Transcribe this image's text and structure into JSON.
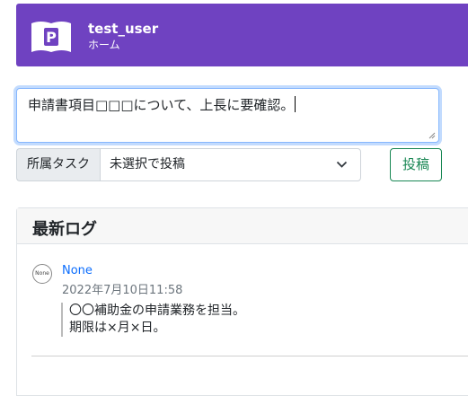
{
  "header": {
    "logo_icon": "book-p-logo-icon",
    "user_name": "test_user",
    "subtitle": "ホーム",
    "background_color": "#6f42c1"
  },
  "post_form": {
    "textarea_value": "申請書項目□□□について、上長に要確認。",
    "task_label": "所属タスク",
    "task_select_value": "未選択で投稿",
    "submit_label": "投稿",
    "submit_color": "#198754"
  },
  "log": {
    "title": "最新ログ",
    "entries": [
      {
        "avatar_text": "None",
        "author": "None",
        "timestamp": "2022年7月10日11:58",
        "lines": [
          "〇〇補助金の申請業務を担当。",
          "期限は×月×日。"
        ]
      }
    ]
  }
}
